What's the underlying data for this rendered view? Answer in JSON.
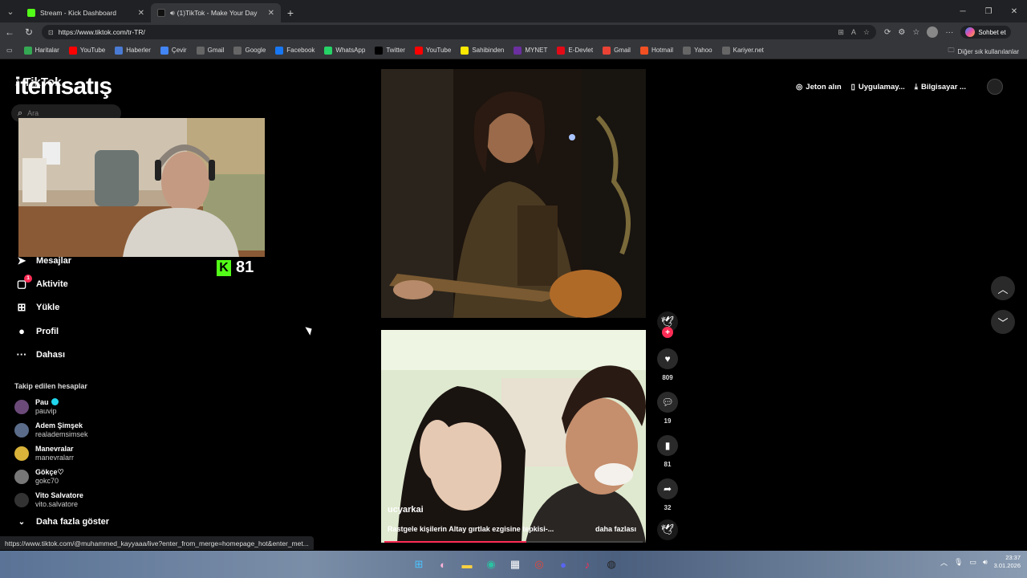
{
  "browser": {
    "tabs": [
      {
        "title": "Stream - Kick Dashboard",
        "favicon_color": "#53fc18",
        "active": false
      },
      {
        "title": "(1)TikTok - Make Your Day",
        "favicon_color": "#111111",
        "active": true
      }
    ],
    "url": "https://www.tiktok.com/tr-TR/",
    "copilot_label": "Sohbet et",
    "bookmarks": [
      {
        "label": "Haritalar",
        "color": "#34a853"
      },
      {
        "label": "YouTube",
        "color": "#ff0000"
      },
      {
        "label": "Haberler",
        "color": "#4a7bd4"
      },
      {
        "label": "Çevir",
        "color": "#4285f4"
      },
      {
        "label": "Gmail",
        "color": "#666"
      },
      {
        "label": "Google",
        "color": "#666"
      },
      {
        "label": "Facebook",
        "color": "#1877f2"
      },
      {
        "label": "WhatsApp",
        "color": "#25d366"
      },
      {
        "label": "Twitter",
        "color": "#000"
      },
      {
        "label": "YouTube",
        "color": "#ff0000"
      },
      {
        "label": "Sahibinden",
        "color": "#ffe800"
      },
      {
        "label": "MYNET",
        "color": "#6b2fa0"
      },
      {
        "label": "E-Devlet",
        "color": "#e30a17"
      },
      {
        "label": "Gmail",
        "color": "#ea4335"
      },
      {
        "label": "Hotmail",
        "color": "#f25022"
      },
      {
        "label": "Yahoo",
        "color": "#666"
      },
      {
        "label": "Kariyer.net",
        "color": "#666"
      }
    ],
    "other_bookmarks": "Diğer sık kullanılanlar",
    "status_url": "https://www.tiktok.com/@muhammed_kayyaaa/live?enter_from_merge=homepage_hot&enter_met..."
  },
  "overlay": {
    "brand": "itemsatış",
    "kick_count": "81"
  },
  "sidebar": {
    "logo": "TikTok",
    "search_placeholder": "Ara",
    "nav": [
      {
        "label": "Mesajlar",
        "icon": "send-icon",
        "badge": ""
      },
      {
        "label": "Aktivite",
        "icon": "message-icon",
        "badge": "1"
      },
      {
        "label": "Yükle",
        "icon": "upload-icon",
        "badge": ""
      },
      {
        "label": "Profil",
        "icon": "profile-icon",
        "badge": ""
      },
      {
        "label": "Dahası",
        "icon": "more-icon",
        "badge": ""
      }
    ],
    "following_title": "Takip edilen hesaplar",
    "following": [
      {
        "name": "Pau",
        "user": "pauvip",
        "verified": true,
        "color": "#6b4a7a"
      },
      {
        "name": "Adem Şimşek",
        "user": "realademsimsek",
        "verified": false,
        "color": "#5a6c8a"
      },
      {
        "name": "Manevralar",
        "user": "manevralarr",
        "verified": false,
        "color": "#d9b23a"
      },
      {
        "name": "Gökçe♡",
        "user": "gokc70",
        "verified": false,
        "color": "#777"
      },
      {
        "name": "Vito Salvatore",
        "user": "vito.salvatore",
        "verified": false,
        "color": "#333"
      }
    ],
    "show_more": "Daha fazla göster"
  },
  "header": {
    "coins": "Jeton alın",
    "app": "Uygulamay...",
    "desktop": "Bilgisayar ..."
  },
  "feed": {
    "video2": {
      "author": "ucyarkai",
      "description": "Rastgele kişilerin Altay gırtlak ezgisine tepkisi-...",
      "more": "daha fazlası",
      "progress": 0.55
    },
    "actions": {
      "likes": "809",
      "comments": "19",
      "saves": "81",
      "shares": "32"
    }
  },
  "taskbar": {
    "time": "23:37",
    "date": "3.01.2026"
  }
}
